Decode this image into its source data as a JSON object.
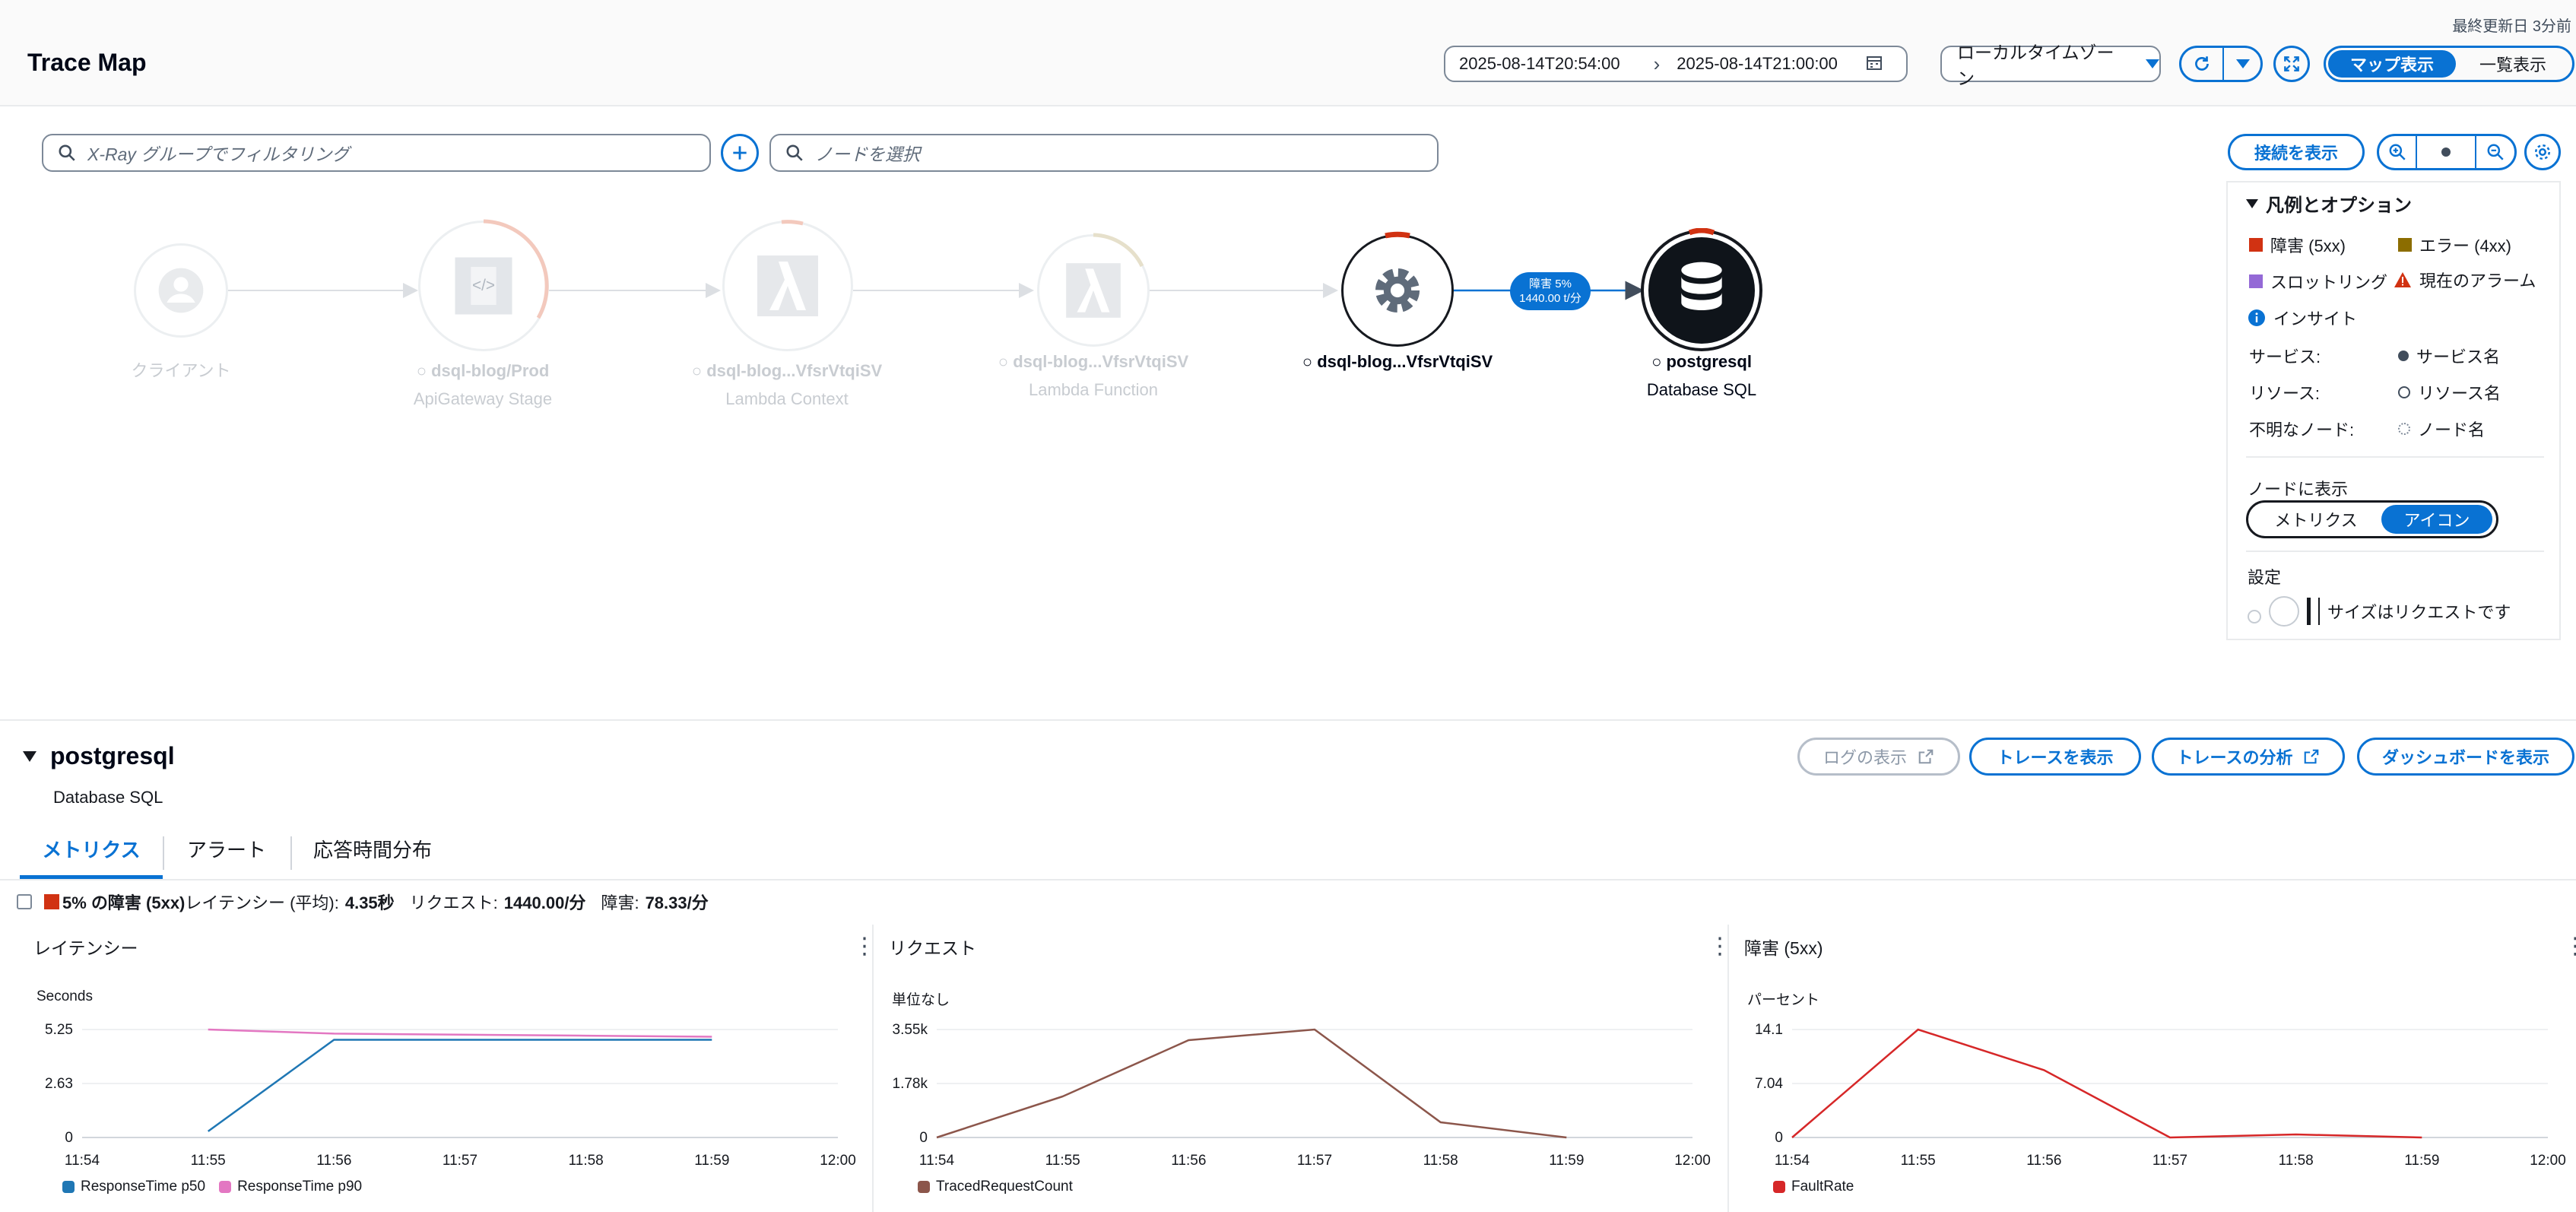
{
  "header": {
    "updated": "最終更新日 3分前",
    "title": "Trace Map",
    "time_from": "2025-08-14T20:54:00",
    "time_to": "2025-08-14T21:00:00",
    "timezone": "ローカルタイムゾーン",
    "map_view": "マップ表示",
    "list_view": "一覧表示"
  },
  "filters": {
    "group_placeholder": "X-Ray グループでフィルタリング",
    "node_placeholder": "ノードを選択",
    "show_connections": "接続を表示"
  },
  "nodes": [
    {
      "name": "クライアント",
      "type": ""
    },
    {
      "name": "dsql-blog/Prod",
      "type": "ApiGateway Stage"
    },
    {
      "name": "dsql-blog...VfsrVtqiSV",
      "type": "Lambda Context"
    },
    {
      "name": "dsql-blog...VfsrVtqiSV",
      "type": "Lambda Function"
    },
    {
      "name": "dsql-blog...VfsrVtqiSV",
      "type": ""
    },
    {
      "name": "postgresql",
      "type": "Database SQL"
    }
  ],
  "edge_badge": {
    "line1": "障害 5%",
    "line2": "1440.00 t/分"
  },
  "legend": {
    "title": "凡例とオプション",
    "fault": "障害 (5xx)",
    "error": "エラー (4xx)",
    "throttling": "スロットリング",
    "alarm": "現在のアラーム",
    "insight": "インサイト",
    "service_label": "サービス:",
    "service_value": "サービス名",
    "resource_label": "リソース:",
    "resource_value": "リソース名",
    "unknown_label": "不明なノード:",
    "unknown_value": "ノード名",
    "node_display": "ノードに表示",
    "metrics": "メトリクス",
    "icon": "アイコン",
    "settings": "設定",
    "size_text": "サイズはリクエストです",
    "colors": {
      "fault": "#d13212",
      "error": "#8c6d00",
      "throttling": "#9469d6",
      "alarm": "#d13212",
      "insight": "#0972d3"
    }
  },
  "detail": {
    "name": "postgresql",
    "type": "Database SQL",
    "btn_logs": "ログの表示",
    "btn_traces": "トレースを表示",
    "btn_analysis": "トレースの分析",
    "btn_dashboard": "ダッシュボードを表示",
    "tabs": [
      "メトリクス",
      "アラート",
      "応答時間分布"
    ],
    "summary_fault": "5% の障害 (5xx)",
    "summary_latency_label": "レイテンシー (平均):",
    "summary_latency": "4.35秒",
    "summary_requests_label": "リクエスト:",
    "summary_requests": "1440.00/分",
    "summary_faults_label": "障害:",
    "summary_faults": "78.33/分"
  },
  "chart_data": [
    {
      "type": "line",
      "title": "レイテンシー",
      "ylabel": "Seconds",
      "x": [
        "11:54",
        "11:55",
        "11:56",
        "11:57",
        "11:58",
        "11:59",
        "12:00"
      ],
      "yticks": [
        "0",
        "2.63",
        "5.25"
      ],
      "ylim": [
        0,
        5.25
      ],
      "series": [
        {
          "name": "ResponseTime p50",
          "color": "#1f77b4",
          "points": [
            [
              1,
              0.3
            ],
            [
              2,
              4.75
            ],
            [
              3,
              4.75
            ],
            [
              4,
              4.75
            ],
            [
              5,
              4.75
            ]
          ]
        },
        {
          "name": "ResponseTime p90",
          "color": "#e377c2",
          "points": [
            [
              1,
              5.25
            ],
            [
              2,
              5.05
            ],
            [
              3,
              5.0
            ],
            [
              4,
              4.95
            ],
            [
              5,
              4.9
            ]
          ]
        }
      ]
    },
    {
      "type": "line",
      "title": "リクエスト",
      "ylabel": "単位なし",
      "x": [
        "11:54",
        "11:55",
        "11:56",
        "11:57",
        "11:58",
        "11:59",
        "12:00"
      ],
      "yticks": [
        "0",
        "1.78k",
        "3.55k"
      ],
      "ylim": [
        0,
        3550
      ],
      "series": [
        {
          "name": "TracedRequestCount",
          "color": "#8c564b",
          "points": [
            [
              0,
              0
            ],
            [
              1,
              1350
            ],
            [
              2,
              3200
            ],
            [
              3,
              3550
            ],
            [
              4,
              500
            ],
            [
              5,
              0
            ]
          ]
        }
      ]
    },
    {
      "type": "line",
      "title": "障害 (5xx)",
      "ylabel": "パーセント",
      "x": [
        "11:54",
        "11:55",
        "11:56",
        "11:57",
        "11:58",
        "11:59",
        "12:00"
      ],
      "yticks": [
        "0",
        "7.04",
        "14.1"
      ],
      "ylim": [
        0,
        14.1
      ],
      "series": [
        {
          "name": "FaultRate",
          "color": "#d62728",
          "points": [
            [
              0,
              0
            ],
            [
              1,
              14.1
            ],
            [
              2,
              8.8
            ],
            [
              3,
              0
            ],
            [
              4,
              0.4
            ],
            [
              5,
              0
            ]
          ]
        }
      ]
    }
  ]
}
